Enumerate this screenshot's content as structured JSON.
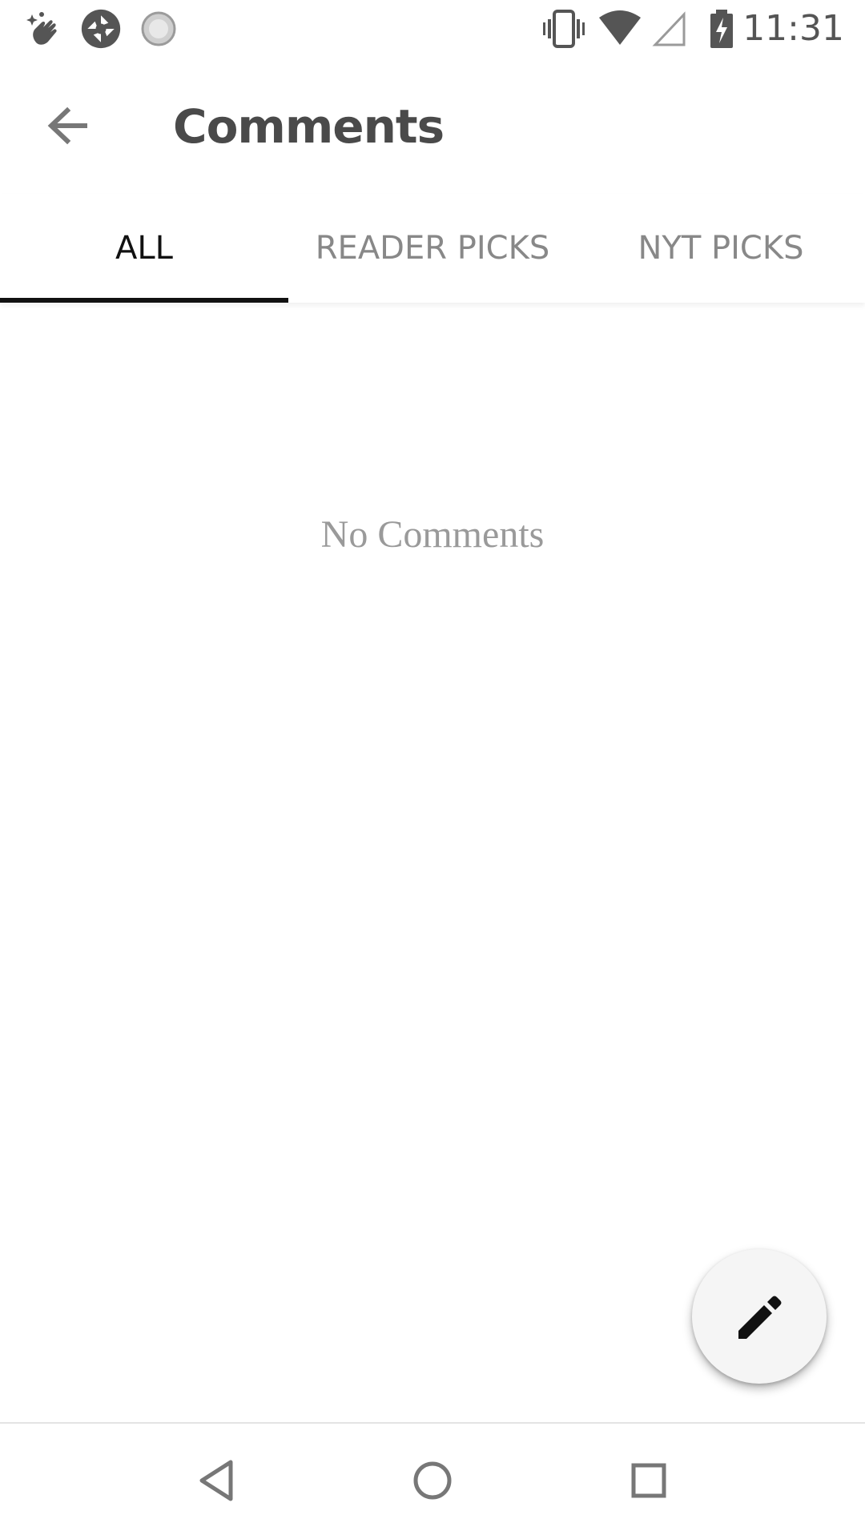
{
  "status_bar": {
    "time": "11:31",
    "left_icons": [
      "hand-sparkle-icon",
      "aperture-icon",
      "loading-circle-icon"
    ],
    "right_icons": [
      "vibrate-icon",
      "wifi-icon",
      "cell-signal-icon",
      "battery-charging-icon"
    ]
  },
  "app_bar": {
    "title": "Comments",
    "back_icon": "arrow-left-icon"
  },
  "tabs": [
    {
      "label": "ALL",
      "active": true
    },
    {
      "label": "READER PICKS",
      "active": false
    },
    {
      "label": "NYT PICKS",
      "active": false
    }
  ],
  "content": {
    "empty_message": "No Comments"
  },
  "fab": {
    "icon": "pencil-icon"
  },
  "nav_bar": {
    "buttons": [
      "back-triangle-icon",
      "home-circle-icon",
      "recents-square-icon"
    ]
  },
  "colors": {
    "title": "#4a4a4a",
    "tab_active": "#111111",
    "tab_inactive": "#888888",
    "empty_text": "#9a9a9a",
    "fab_bg": "#f5f5f5"
  }
}
